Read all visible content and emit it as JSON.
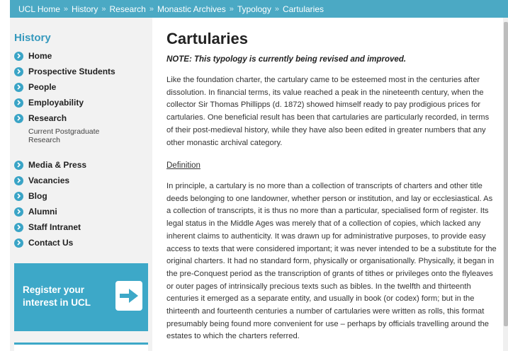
{
  "breadcrumb": [
    {
      "label": "UCL Home"
    },
    {
      "label": "History"
    },
    {
      "label": "Research"
    },
    {
      "label": "Monastic Archives"
    },
    {
      "label": "Typology"
    },
    {
      "label": "Cartularies"
    }
  ],
  "sidebar": {
    "title": "History",
    "items": [
      {
        "label": "Home"
      },
      {
        "label": "Prospective Students"
      },
      {
        "label": "People"
      },
      {
        "label": "Employability"
      },
      {
        "label": "Research"
      },
      {
        "label": "Media & Press"
      },
      {
        "label": "Vacancies"
      },
      {
        "label": "Blog"
      },
      {
        "label": "Alumni"
      },
      {
        "label": "Staff Intranet"
      },
      {
        "label": "Contact Us"
      }
    ],
    "subitem": "Current Postgraduate Research",
    "promo": {
      "text": "Register your interest in UCL"
    },
    "colors": {
      "accent": "#3aa4c6",
      "background": "#f2f2f2"
    }
  },
  "main": {
    "title": "Cartularies",
    "note": "NOTE: This typology is currently being revised and improved.",
    "paragraph1": [
      "Like the foundation charter, the cartulary came to be esteemed most in the centuries after",
      "dissolution. In financial terms, its value reached a peak in the nineteenth century, when the",
      "collector Sir Thomas Phillipps (d. 1872) showed himself ready to pay prodigious prices for",
      "cartularies. One beneficial result has been that cartularies are particularly recorded, in terms",
      "of their post-medieval history, while they have also been edited in greater numbers that any",
      "other monastic archival category."
    ],
    "definition_link": "Definition",
    "paragraph2": [
      "In principle, a cartulary is no more than a collection of transcripts of charters and other title",
      "deeds belonging to one landowner, whether person or institution, and lay or ecclesiastical. As",
      "a collection of transcripts, it is thus no more than a particular, specialised form of register. Its",
      "legal status in the Middle Ages was merely that of a collection of copies, which lacked any",
      "inherent claims to authenticity. It was drawn up for administrative purposes, to provide easy",
      "access to texts that were considered important; it was never intended to be a substitute for the",
      "original charters. It had no standard form, physically or organisationally. Physically, it began in",
      "the pre-Conquest period as the transcription of grants of tithes or privileges onto the flyleaves",
      "or outer pages of intrinsically precious texts such as bibles. In the twelfth and thirteenth",
      "centuries it emerged as a separate entity, and usually in book (or codex) form; but in the",
      "thirteenth and fourteenth centuries a number of cartularies were written as rolls, this format",
      "presumably being found more convenient for use – perhaps by officials travelling around the",
      "estates to which the charters referred."
    ]
  },
  "colors": {
    "breadcrumb_bar": "#4ba9c4",
    "title_accent": "#3599bd"
  }
}
